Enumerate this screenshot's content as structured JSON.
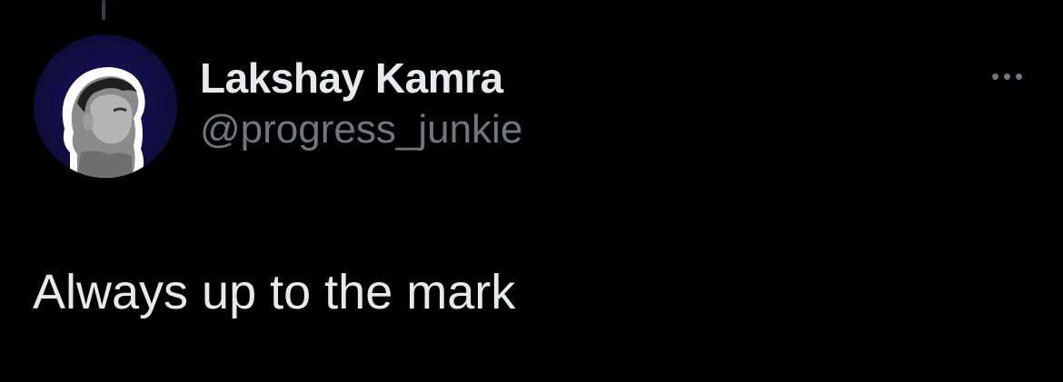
{
  "tweet": {
    "author": {
      "display_name": "Lakshay Kamra",
      "handle": "@progress_junkie",
      "avatar_icon": "profile-photo"
    },
    "text": "Always up to the mark",
    "more_icon": "ellipsis-icon"
  },
  "colors": {
    "background": "#000000",
    "primary_text": "#e7e9ea",
    "secondary_text": "#71767b",
    "avatar_bg": "#15104a"
  }
}
